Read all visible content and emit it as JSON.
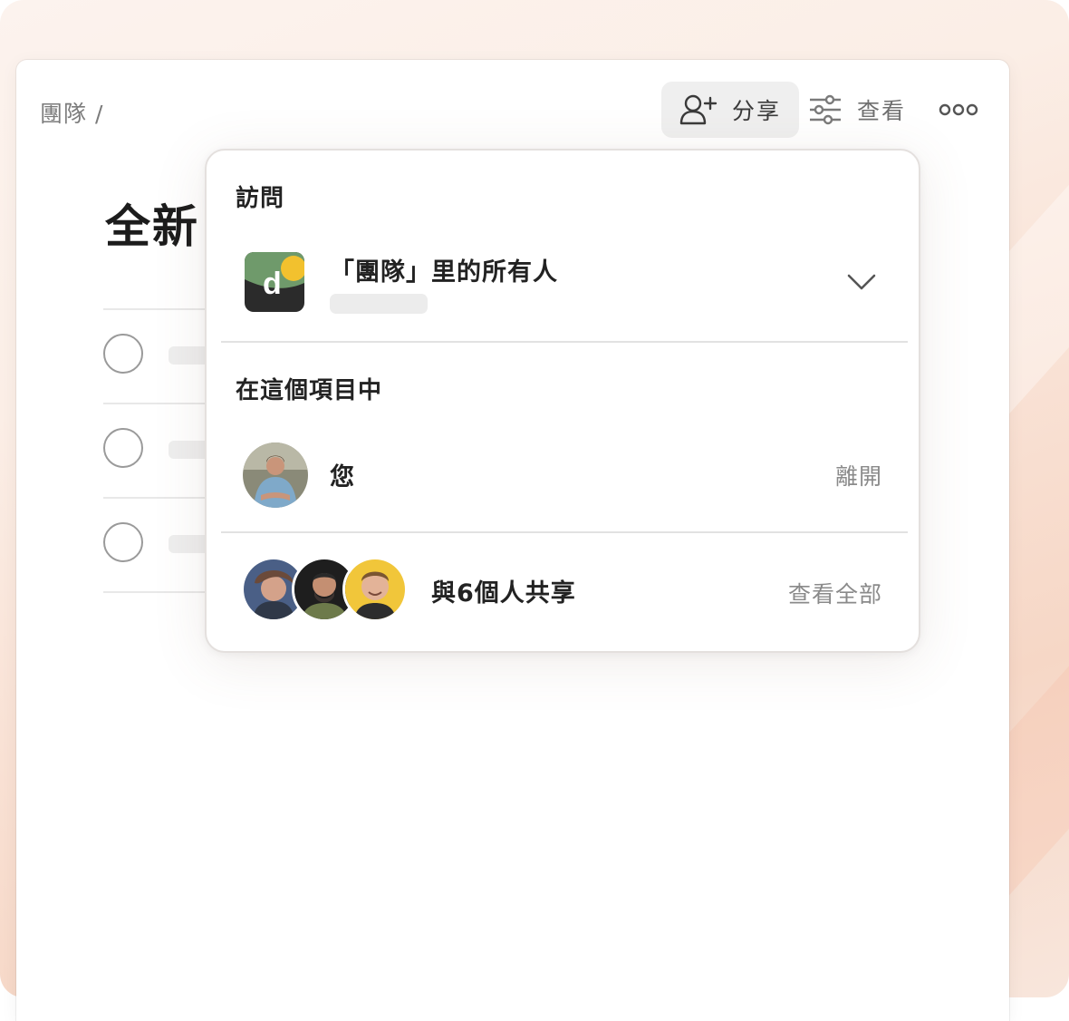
{
  "header": {
    "breadcrumb": "團隊 /",
    "share_label": "分享",
    "view_label": "查看"
  },
  "page": {
    "title": "全新",
    "tasks": [
      {},
      {},
      {}
    ]
  },
  "share_popover": {
    "access_section_title": "訪問",
    "access_item": {
      "logo_letter": "d",
      "name": "「團隊」里的所有人"
    },
    "project_section_title": "在這個項目中",
    "member": {
      "name": "您",
      "action": "離開"
    },
    "shared": {
      "label": "與6個人共享",
      "action": "查看全部"
    }
  },
  "icons": {
    "share": "add-person-icon",
    "view": "sliders-icon",
    "more": "more-dots-icon",
    "dropdown": "chevron-down-icon"
  },
  "colors": {
    "logo_green": "#6a9a6a",
    "logo_dark": "#2b2b2b",
    "logo_yellow": "#f2c12e"
  }
}
